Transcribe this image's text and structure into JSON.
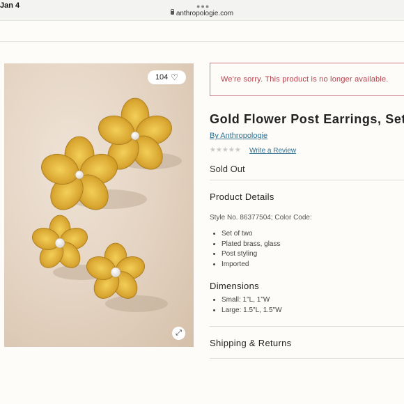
{
  "browser": {
    "status_date": "Jan 4",
    "url": "anthropologie.com"
  },
  "product": {
    "favorite_count": "104",
    "icons": {
      "favorite": "heart-icon",
      "expand": "expand-icon",
      "lock": "lock-icon"
    },
    "unavailable_message": "We're sorry. This product is no longer available.",
    "title": "Gold Flower Post Earrings, Set of",
    "brand": "By Anthropologie",
    "stars": "★★★★★",
    "rating_value": 0,
    "review_link": "Write a Review",
    "availability": "Sold Out",
    "details_heading": "Product Details",
    "style_line": "Style No. 86377504; Color Code:",
    "features": [
      "Set of two",
      "Plated brass, glass",
      "Post styling",
      "Imported"
    ],
    "dimensions_heading": "Dimensions",
    "dimensions": [
      "Small: 1\"L, 1\"W",
      "Large: 1.5\"L, 1.5\"W"
    ],
    "shipping_heading": "Shipping & Returns"
  },
  "colors": {
    "alert_border": "#d17c85",
    "alert_text": "#b5404d",
    "link": "#2f6e8c",
    "background": "#fdfcf8"
  }
}
